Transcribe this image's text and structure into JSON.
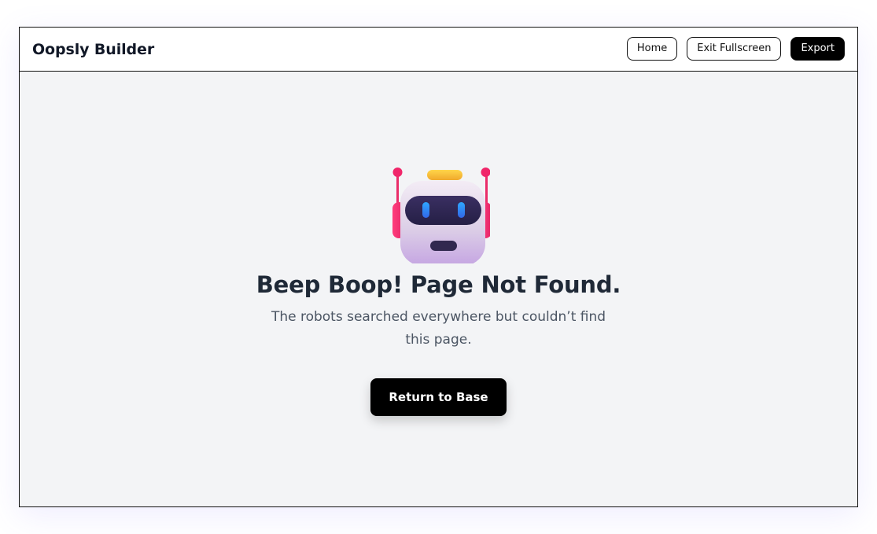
{
  "app": {
    "title": "Oopsly Builder"
  },
  "nav": {
    "home_label": "Home",
    "fullscreen_label": "Exit Fullscreen",
    "export_label": "Export"
  },
  "error": {
    "headline": "Beep Boop! Page Not Found.",
    "message": "The robots searched everywhere but couldn’t find this page.",
    "cta_label": "Return to Base",
    "illustration": "robot-icon"
  },
  "colors": {
    "accent": "#000000",
    "background": "#f3f4f6",
    "heading": "#1f2937",
    "body_text": "#4b5563",
    "robot_antenna": "#f0266a",
    "robot_eyes": "#3b82f6",
    "robot_top_light": "#fbbf24"
  }
}
